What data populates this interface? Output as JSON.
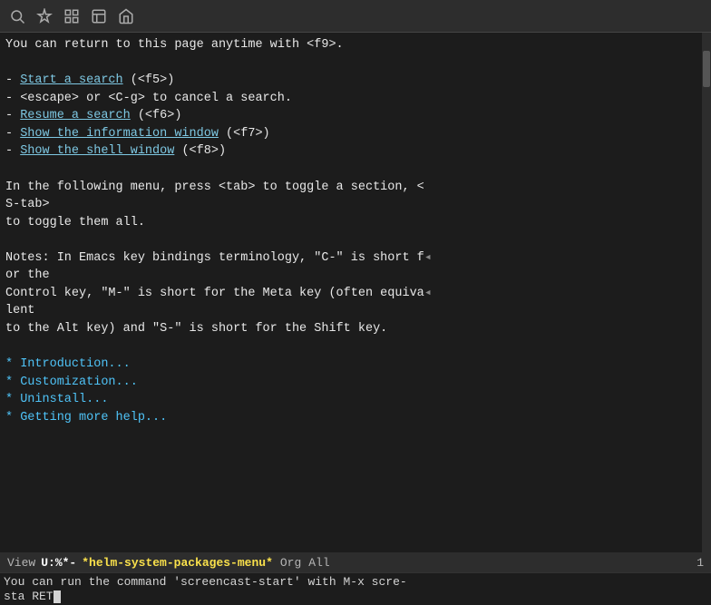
{
  "toolbar": {
    "icons": [
      {
        "name": "search-icon",
        "symbol": "🔍"
      },
      {
        "name": "magic-icon",
        "symbol": "✨"
      },
      {
        "name": "find-icon",
        "symbol": "🔎"
      },
      {
        "name": "bookmark-icon",
        "symbol": "📄"
      },
      {
        "name": "home-icon",
        "symbol": "🏠"
      }
    ]
  },
  "content": {
    "lines": [
      {
        "id": "l1",
        "text": "You can return to this page anytime with <f9>."
      },
      {
        "id": "l2",
        "text": ""
      },
      {
        "id": "l3",
        "text": "- ",
        "link": "Start a search",
        "after": " (<f5>)"
      },
      {
        "id": "l4",
        "text": "- <escape> or <C-g> to cancel a search."
      },
      {
        "id": "l5",
        "text": "- ",
        "link": "Resume a search",
        "after": " (<f6>)"
      },
      {
        "id": "l6",
        "text": "- ",
        "link": "Show the information window",
        "after": " (<f7>)"
      },
      {
        "id": "l7",
        "text": "- ",
        "link": "Show the shell window",
        "after": " (<f8>)"
      },
      {
        "id": "l8",
        "text": ""
      },
      {
        "id": "l9",
        "text": "In the following menu, press <tab> to toggle a section, <"
      },
      {
        "id": "l10",
        "text": "S-tab>"
      },
      {
        "id": "l11",
        "text": "to toggle them all."
      },
      {
        "id": "l12",
        "text": ""
      },
      {
        "id": "l13",
        "text": "Notes: In Emacs key bindings terminology, \"C-\" is short f"
      },
      {
        "id": "l14",
        "text": "or the"
      },
      {
        "id": "l15",
        "text": "Control key, \"M-\" is short for the Meta key (often equiva"
      },
      {
        "id": "l16",
        "text": "lent"
      },
      {
        "id": "l17",
        "text": "to the Alt key) and \"S-\" is short for the Shift key."
      },
      {
        "id": "l18",
        "text": ""
      },
      {
        "id": "l19",
        "text": "* Introduction..."
      },
      {
        "id": "l20",
        "text": "* Customization..."
      },
      {
        "id": "l21",
        "text": "* Uninstall..."
      },
      {
        "id": "l22",
        "text": "* Getting more help..."
      }
    ]
  },
  "status_bar": {
    "view": "View",
    "mode": "U:%*-",
    "buffer": "*helm-system-packages-menu*",
    "org": "Org",
    "all": "All",
    "num": "1"
  },
  "minibuffer": {
    "line1": "You can run the command 'screencast-start' with M-x scre-",
    "line2": "sta RET"
  }
}
